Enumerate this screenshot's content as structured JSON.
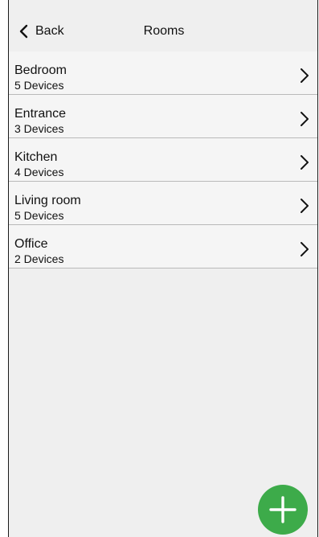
{
  "header": {
    "back_label": "Back",
    "title": "Rooms"
  },
  "rooms": [
    {
      "name": "Bedroom",
      "devices": "5 Devices"
    },
    {
      "name": "Entrance",
      "devices": "3 Devices"
    },
    {
      "name": "Kitchen",
      "devices": "4 Devices"
    },
    {
      "name": "Living room",
      "devices": "5 Devices"
    },
    {
      "name": "Office",
      "devices": "2 Devices"
    }
  ],
  "fab": {
    "icon": "plus-icon",
    "color": "#3dab4a"
  },
  "colors": {
    "background": "#efefef",
    "list_item": "#f5f5f5",
    "divider": "#b9b9b9",
    "accent": "#3dab4a"
  }
}
